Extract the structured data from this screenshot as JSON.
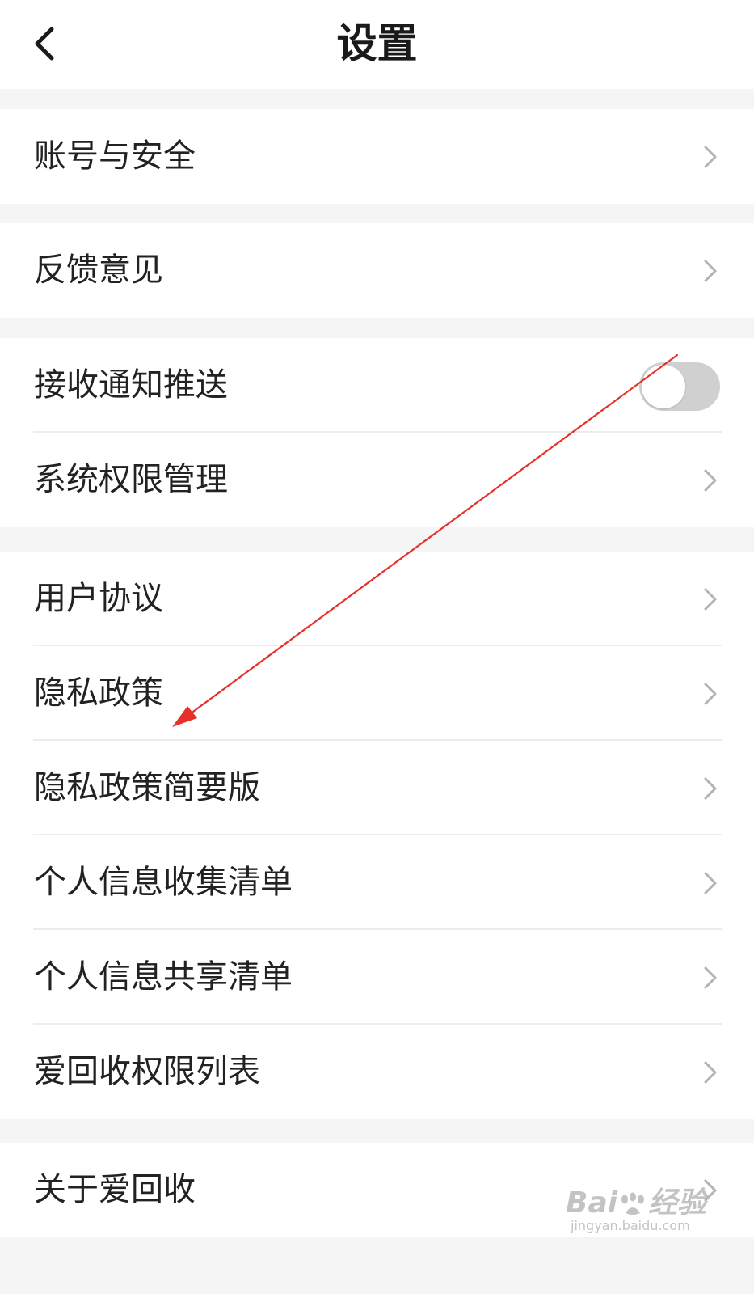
{
  "header": {
    "title": "设置",
    "back_icon": "chevron-left-icon"
  },
  "groups": [
    {
      "items": [
        {
          "label": "账号与安全",
          "control": "chevron"
        }
      ]
    },
    {
      "items": [
        {
          "label": "反馈意见",
          "control": "chevron"
        }
      ]
    },
    {
      "items": [
        {
          "label": "接收通知推送",
          "control": "toggle",
          "toggle_on": false
        },
        {
          "label": "系统权限管理",
          "control": "chevron"
        }
      ]
    },
    {
      "items": [
        {
          "label": "用户协议",
          "control": "chevron"
        },
        {
          "label": "隐私政策",
          "control": "chevron"
        },
        {
          "label": "隐私政策简要版",
          "control": "chevron"
        },
        {
          "label": "个人信息收集清单",
          "control": "chevron"
        },
        {
          "label": "个人信息共享清单",
          "control": "chevron"
        },
        {
          "label": "爱回收权限列表",
          "control": "chevron"
        }
      ]
    },
    {
      "items": [
        {
          "label": "关于爱回收",
          "control": "chevron"
        }
      ]
    }
  ],
  "annotation": {
    "type": "red-arrow",
    "color": "#e8302a",
    "points_to": "隐私政策"
  },
  "watermark": {
    "brand_left": "Bai",
    "brand_right": "经验",
    "url": "jingyan.baidu.com"
  },
  "colors": {
    "background": "#f5f5f5",
    "card": "#ffffff",
    "text": "#222222",
    "chevron": "#b3b3b3",
    "toggle_off": "#d0d0d0"
  }
}
